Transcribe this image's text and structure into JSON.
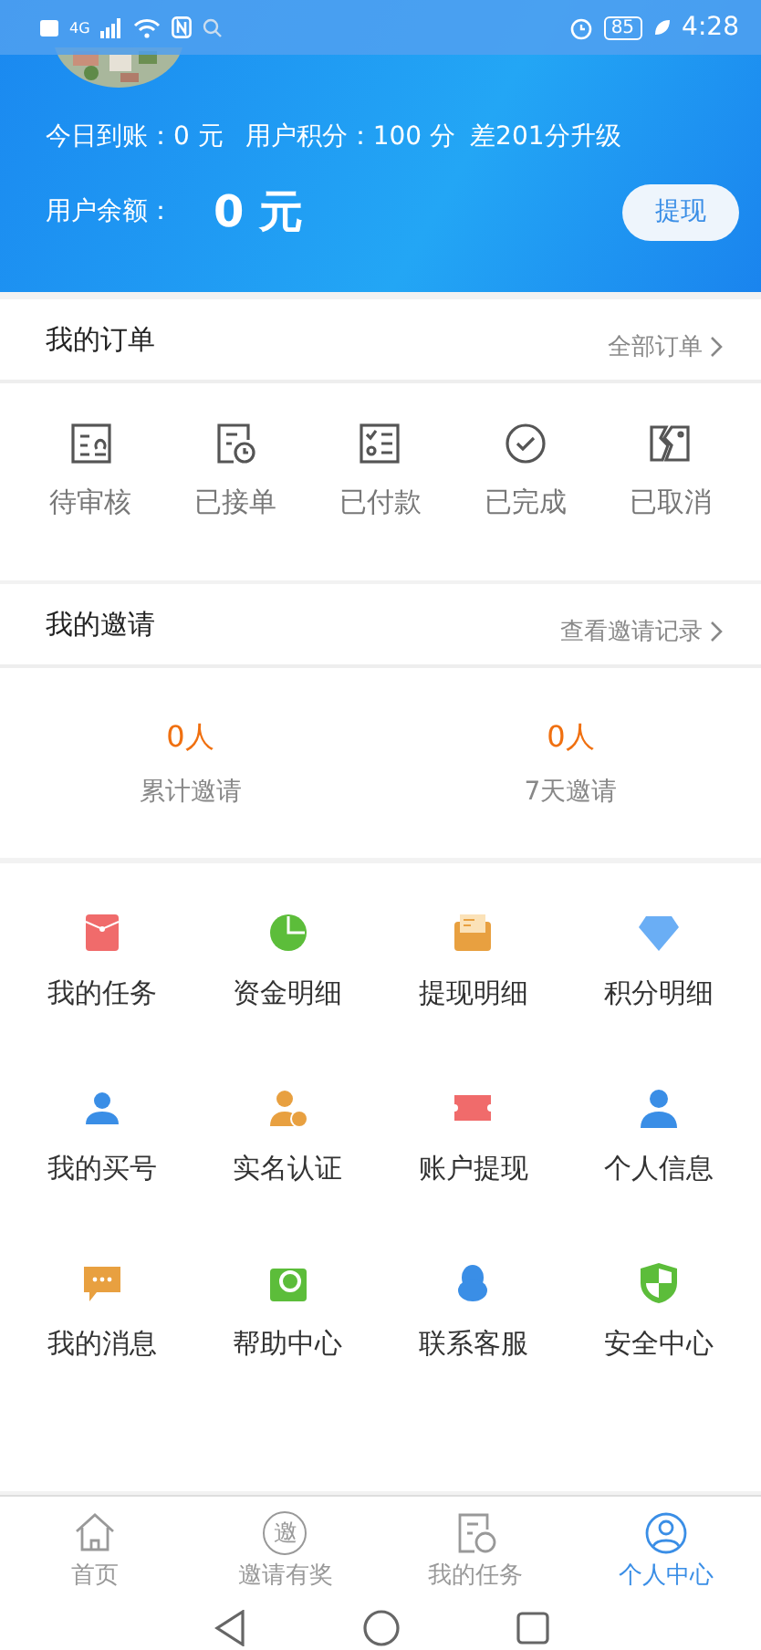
{
  "status_bar": {
    "network": "4G",
    "battery": "85",
    "time": "4:28"
  },
  "header": {
    "today_label": "今日到账：",
    "today_value": "0 元",
    "points_label": "用户积分：",
    "points_value": "100 分",
    "upgrade": "差201分升级",
    "balance_label": "用户余额：",
    "balance_value": "0 元",
    "withdraw_button": "提现"
  },
  "orders": {
    "title": "我的订单",
    "link": "全部订单",
    "items": [
      "待审核",
      "已接单",
      "已付款",
      "已完成",
      "已取消"
    ]
  },
  "invites": {
    "title": "我的邀请",
    "link": "查看邀请记录",
    "stats": [
      {
        "value": "0人",
        "label": "累计邀请"
      },
      {
        "value": "0人",
        "label": "7天邀请"
      }
    ]
  },
  "menu": [
    "我的任务",
    "资金明细",
    "提现明细",
    "积分明细",
    "我的买号",
    "实名认证",
    "账户提现",
    "个人信息",
    "我的消息",
    "帮助中心",
    "联系客服",
    "安全中心"
  ],
  "tab_bar": [
    {
      "label": "首页",
      "selected": false
    },
    {
      "label": "邀请有奖",
      "icon_text": "邀",
      "selected": false
    },
    {
      "label": "我的任务",
      "selected": false
    },
    {
      "label": "个人中心",
      "selected": true
    }
  ]
}
